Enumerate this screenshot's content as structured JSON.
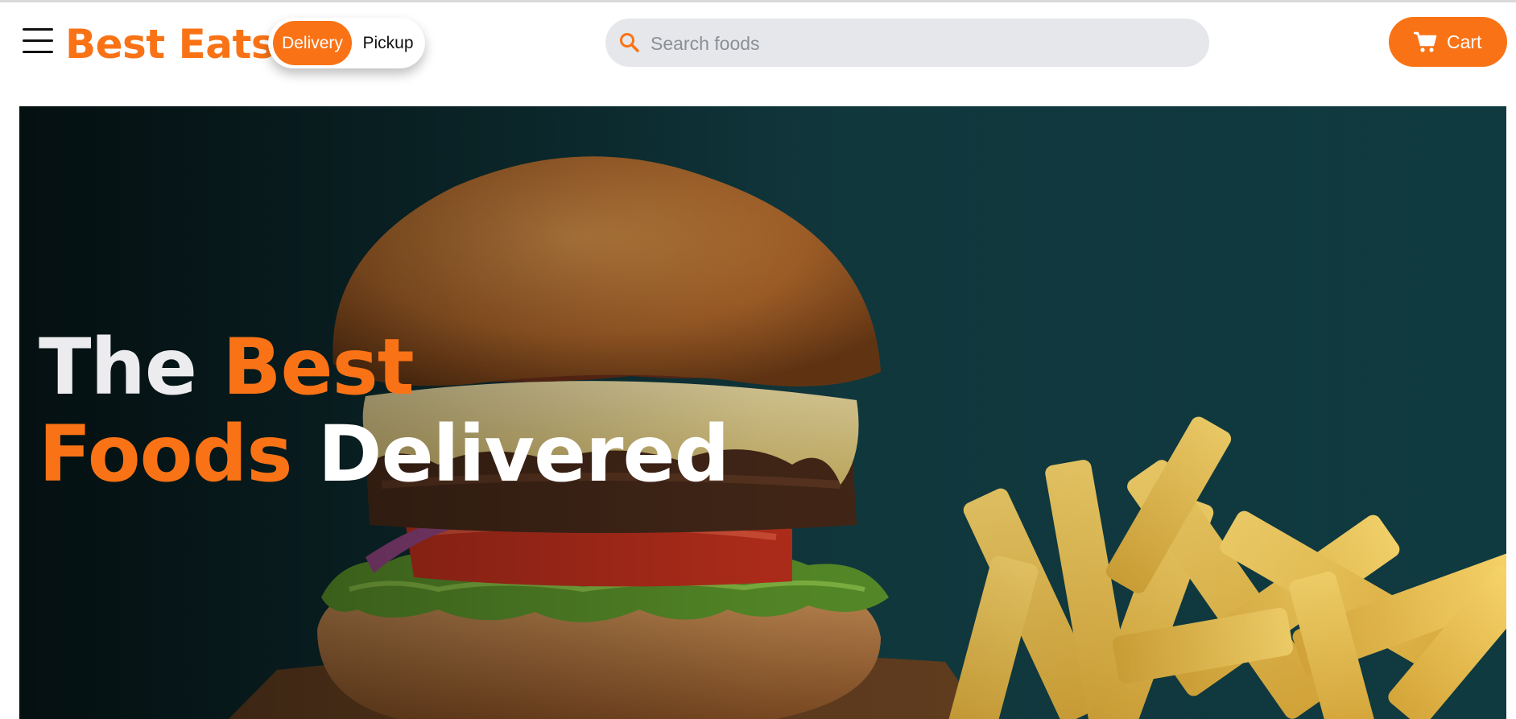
{
  "header": {
    "menu_icon": "hamburger-menu-icon",
    "logo": "Best Eats",
    "mode_toggle": {
      "options": [
        "Delivery",
        "Pickup"
      ],
      "selected": "Delivery"
    },
    "search": {
      "placeholder": "Search foods",
      "value": "",
      "icon": "search-icon"
    },
    "cart": {
      "label": "Cart",
      "icon": "cart-icon"
    }
  },
  "hero": {
    "title_parts": [
      {
        "text": "The",
        "color": "#ececef"
      },
      {
        "text": "Best",
        "color": "#f97316"
      },
      {
        "text": "Foods",
        "color": "#f97316"
      },
      {
        "text": "Delivered",
        "color": "#ffffff"
      }
    ],
    "image": "burger-and-fries-photo"
  },
  "colors": {
    "accent": "#f97316",
    "search_bg": "#e5e7eb",
    "hero_bg": "#0f3a40"
  }
}
